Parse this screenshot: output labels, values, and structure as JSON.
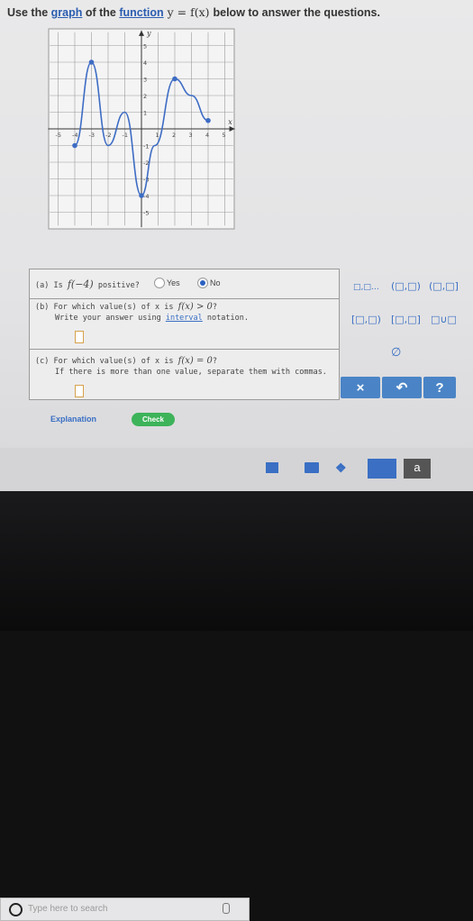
{
  "header": {
    "prefix": "Use the ",
    "graph_link": "graph",
    "middle": " of the ",
    "function_link": "function",
    "formula": " y = f(x) ",
    "suffix": "below to answer the questions."
  },
  "graph": {
    "y_axis_label": "y",
    "x_axis_label": "x",
    "x_ticks": [
      "-5",
      "-4",
      "-3",
      "-2",
      "-1",
      "1",
      "2",
      "3",
      "4",
      "5"
    ],
    "y_ticks": [
      "5",
      "4",
      "3",
      "2",
      "1",
      "-1",
      "-2",
      "-3",
      "-4",
      "-5"
    ],
    "x_range": [
      -5,
      5
    ],
    "y_range": [
      -5,
      5
    ],
    "curve_points": [
      [
        -4,
        -1
      ],
      [
        -3,
        4
      ],
      [
        -2,
        -1
      ],
      [
        -1,
        1
      ],
      [
        0,
        -4
      ],
      [
        0.8,
        -1
      ],
      [
        2,
        3
      ],
      [
        3,
        2
      ],
      [
        4,
        0.5
      ]
    ],
    "closed_endpoints": [
      [
        -4,
        -1
      ],
      [
        -3,
        4
      ],
      [
        0,
        -4
      ],
      [
        2,
        3
      ],
      [
        4,
        0.5
      ]
    ],
    "colors": {
      "curve": "#3d6cc4",
      "grid": "#9a9a9a",
      "axis": "#333333"
    }
  },
  "questions": {
    "a": {
      "prefix": "(a) Is ",
      "math": "f(−4)",
      "suffix": " positive?",
      "option_yes": "Yes",
      "option_no": "No",
      "selected": "No"
    },
    "b": {
      "prefix": "(b) For which value(s) of x is ",
      "math": "f(x) > 0",
      "suffix": "?",
      "hint_prefix": "Write your answer using ",
      "hint_link": "interval",
      "hint_suffix": " notation."
    },
    "c": {
      "prefix": "(c) For which value(s) of x is ",
      "math": "f(x) = 0",
      "suffix": "?",
      "hint": "If there is more than one value, separate them with commas."
    }
  },
  "palette": {
    "row1": [
      "□,□…",
      "(□,□)",
      "(□,□]"
    ],
    "row2": [
      "[□,□)",
      "[□,□]",
      "□∪□"
    ],
    "empty_set": "∅",
    "clear": "×",
    "undo": "↶",
    "help": "?"
  },
  "footer": {
    "explanation": "Explanation",
    "check": "Check"
  },
  "taskbar": {
    "search_placeholder": "Type here to search"
  },
  "colors": {
    "accent_blue": "#3a6fc4",
    "check_green": "#3db35a",
    "answer_border": "#d6a24a",
    "button_bg": "#4a84c6"
  }
}
